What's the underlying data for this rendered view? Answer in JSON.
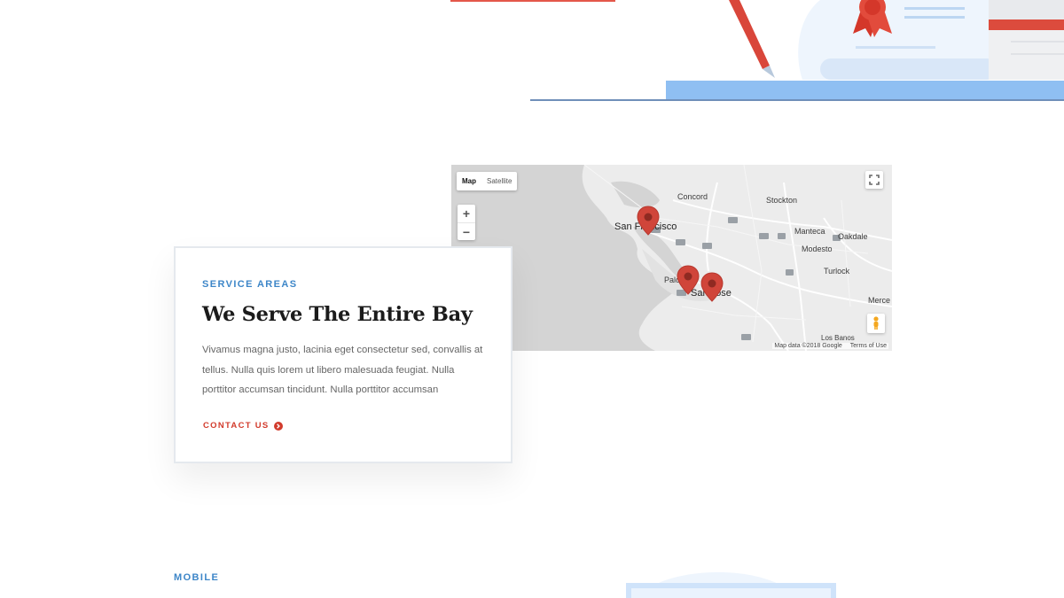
{
  "map": {
    "type_controls": {
      "map": "Map",
      "satellite": "Satellite"
    },
    "zoom": {
      "in": "+",
      "out": "−"
    },
    "cities": {
      "concord": "Concord",
      "stockton": "Stockton",
      "san_francisco": "San Francisco",
      "manteca": "Manteca",
      "oakdale": "Oakdale",
      "modesto": "Modesto",
      "turlock": "Turlock",
      "palo_alto": "Palo Alto",
      "san_jose": "San Jose",
      "merced": "Merce",
      "los_banos": "Los Banos"
    },
    "attribution": {
      "data": "Map data ©2018 Google",
      "terms": "Terms of Use"
    },
    "marker_color": "#d0453a"
  },
  "service": {
    "eyebrow": "SERVICE AREAS",
    "title": "We Serve The Entire Bay",
    "body": "Vivamus magna justo, lacinia eget consectetur sed, convallis at tellus. Nulla quis lorem ut libero malesuada feugiat. Nulla porttitor accumsan tincidunt. Nulla porttitor accumsan",
    "cta": "CONTACT US"
  },
  "mobile": {
    "eyebrow": "MOBILE"
  },
  "colors": {
    "accent_blue": "#3d86c8",
    "accent_red": "#d23b2c",
    "illus_blue": "#8fbff2"
  }
}
